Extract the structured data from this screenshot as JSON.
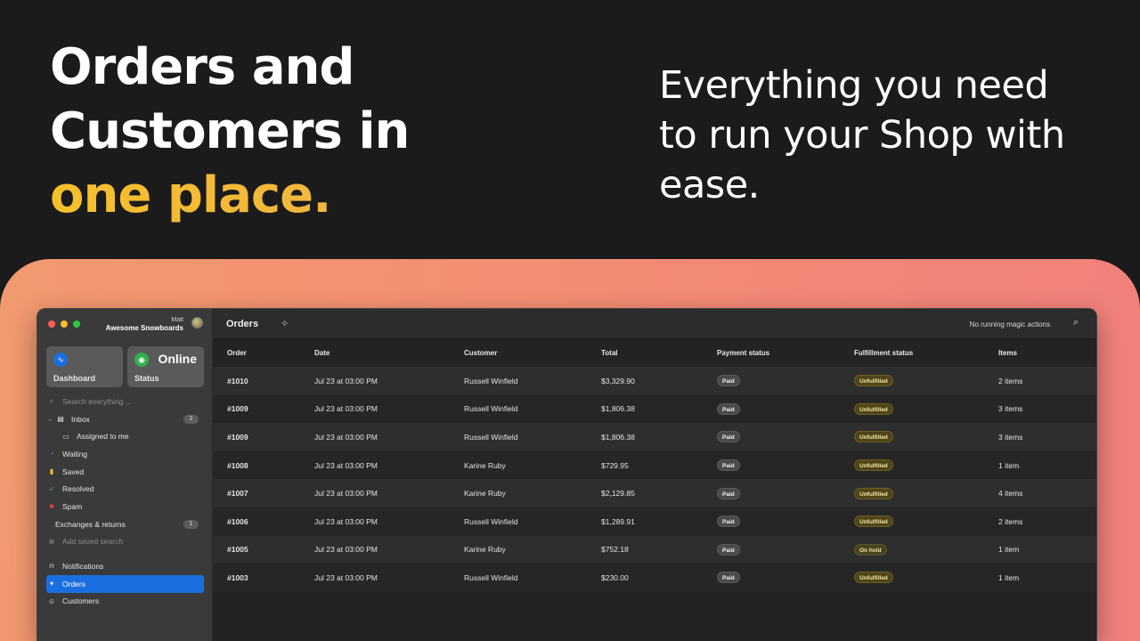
{
  "hero": {
    "left_line1": "Orders and",
    "left_line2": "Customers in",
    "left_line3": "one place.",
    "right_line1": "Everything you need",
    "right_line2": "to run your Shop with",
    "right_line3": "ease."
  },
  "colors": {
    "accent": "#f5c02b",
    "panel": "#f48d74",
    "selected": "#1a6fe0"
  },
  "account": {
    "user": "Matt",
    "shop": "Awesome Snowboards"
  },
  "tiles": {
    "dashboard": {
      "label": "Dashboard",
      "icon": "activity-icon"
    },
    "status": {
      "label": "Status",
      "value": "Online",
      "icon": "broadcast-icon"
    }
  },
  "sidebar": {
    "search_placeholder": "Search everything ...",
    "items": [
      {
        "label": "Inbox",
        "badge": "2",
        "icon": "tray-icon"
      },
      {
        "label": "Assigned to me",
        "icon": "tray-icon"
      },
      {
        "label": "Waiting",
        "icon": "clock-icon"
      },
      {
        "label": "Saved",
        "icon": "bookmark-icon"
      },
      {
        "label": "Resolved",
        "icon": "check-icon"
      },
      {
        "label": "Spam",
        "icon": "trash-icon"
      },
      {
        "label": "Exchanges & returns",
        "badge": "1"
      },
      {
        "label": "Add saved search",
        "icon": "plus-circle-icon"
      },
      {
        "label": "Notifications",
        "icon": "bell-icon"
      },
      {
        "label": "Orders",
        "icon": "cart-icon"
      },
      {
        "label": "Customers",
        "icon": "people-icon"
      }
    ]
  },
  "topbar": {
    "title": "Orders",
    "running": "No running magic actions"
  },
  "table": {
    "headers": [
      "Order",
      "Date",
      "Customer",
      "Total",
      "Payment status",
      "Fulfillment status",
      "Items"
    ],
    "rows": [
      [
        "#1010",
        "Jul 23 at 03:00 PM",
        "Russell Winfield",
        "$3,329.90",
        "Paid",
        "Unfulfilled",
        "2 items"
      ],
      [
        "#1009",
        "Jul 23 at 03:00 PM",
        "Russell Winfield",
        "$1,806.38",
        "Paid",
        "Unfulfilled",
        "3 items"
      ],
      [
        "#1009",
        "Jul 23 at 03:00 PM",
        "Russell Winfield",
        "$1,806.38",
        "Paid",
        "Unfulfilled",
        "3 items"
      ],
      [
        "#1008",
        "Jul 23 at 03:00 PM",
        "Karine Ruby",
        "$729.95",
        "Paid",
        "Unfulfilled",
        "1 item"
      ],
      [
        "#1007",
        "Jul 23 at 03:00 PM",
        "Karine Ruby",
        "$2,129.85",
        "Paid",
        "Unfulfilled",
        "4 items"
      ],
      [
        "#1006",
        "Jul 23 at 03:00 PM",
        "Russell Winfield",
        "$1,289.91",
        "Paid",
        "Unfulfilled",
        "2 items"
      ],
      [
        "#1005",
        "Jul 23 at 03:00 PM",
        "Karine Ruby",
        "$752.18",
        "Paid",
        "On hold",
        "1 item"
      ],
      [
        "#1003",
        "Jul 23 at 03:00 PM",
        "Russell Winfield",
        "$230.00",
        "Paid",
        "Unfulfilled",
        "1 item"
      ]
    ]
  }
}
